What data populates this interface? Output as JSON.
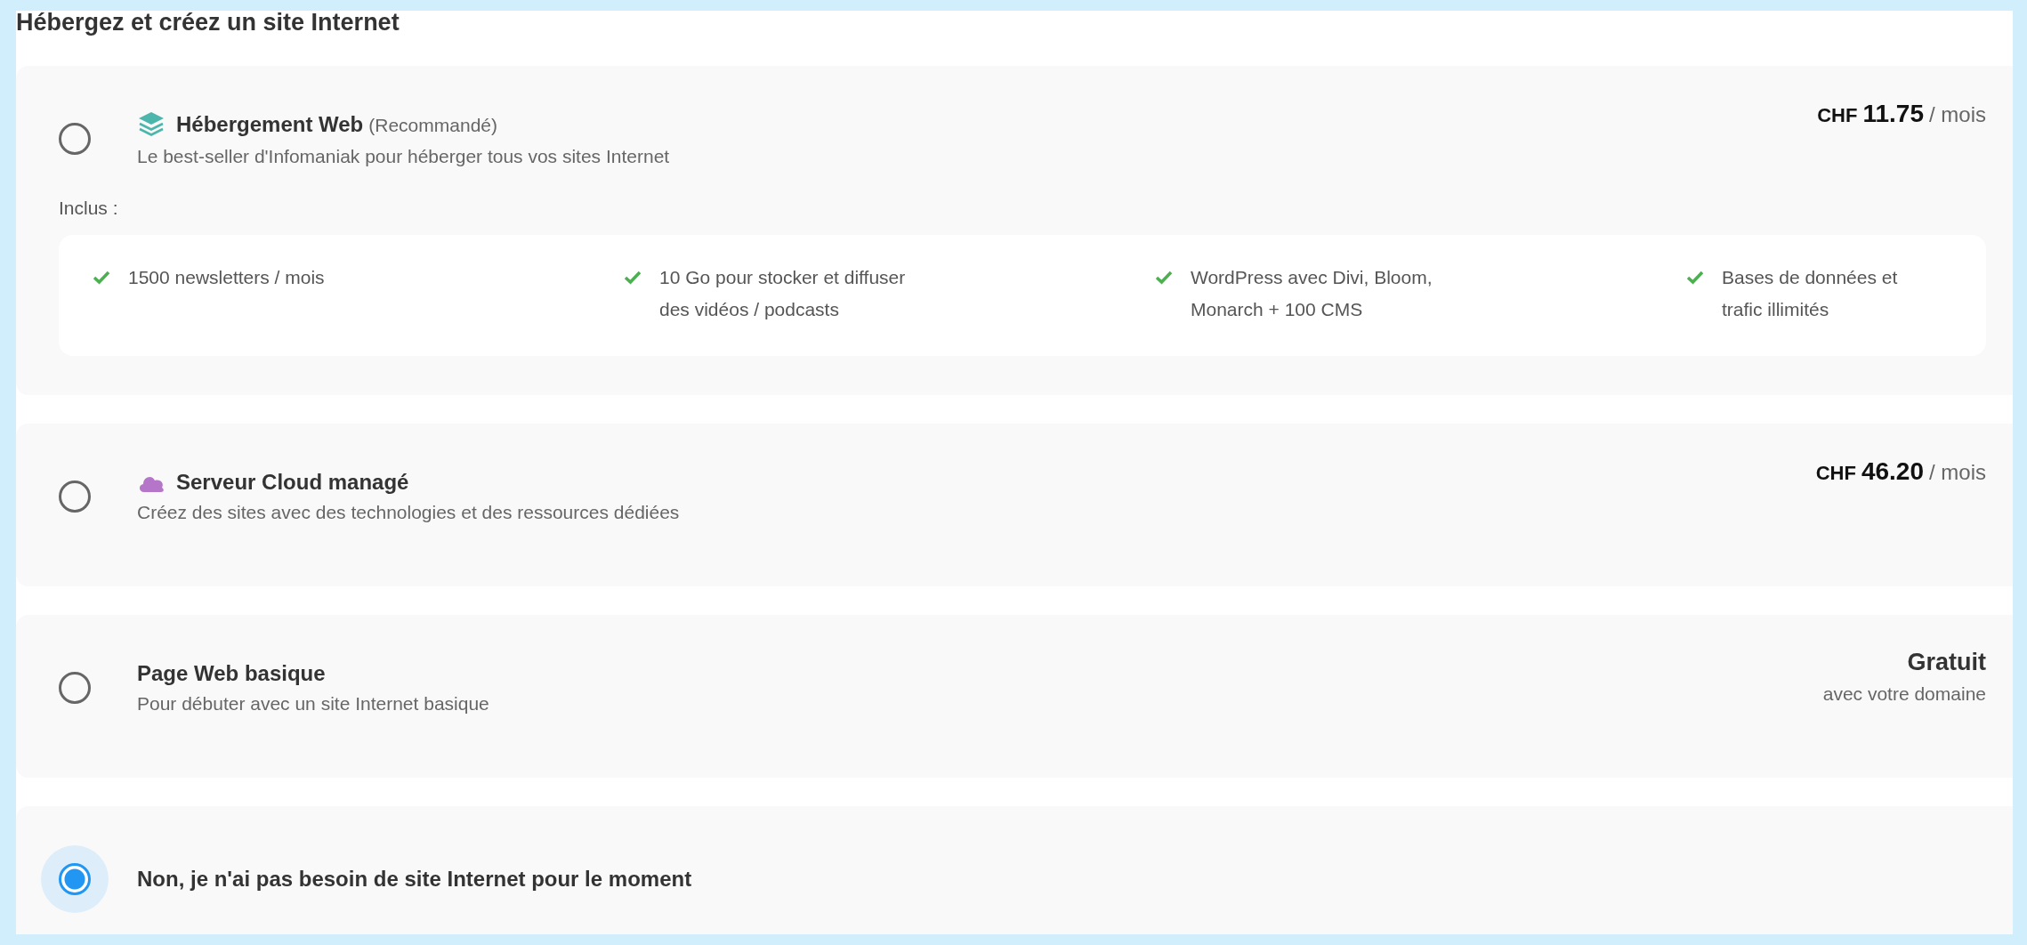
{
  "title": "Hébergez et créez un site Internet",
  "options": [
    {
      "kind": "web_hosting",
      "name": "Hébergement Web",
      "note": "(Recommandé)",
      "description": "Le best-seller d'Infomaniak pour héberger tous vos sites Internet",
      "selected": false,
      "price": {
        "kind": "monthly",
        "currency": "CHF",
        "amount": "11.75",
        "period": "/ mois"
      },
      "included_label": "Inclus :",
      "features": [
        "1500 newsletters / mois",
        "10 Go pour stocker et diffuser des vidéos / podcasts",
        "WordPress avec Divi, Bloom, Monarch + 100 CMS",
        "Bases de données et trafic illimités"
      ]
    },
    {
      "kind": "cloud_server",
      "name": "Serveur Cloud managé",
      "description": "Créez des sites avec des technologies et des ressources dédiées",
      "selected": false,
      "price": {
        "kind": "monthly",
        "currency": "CHF",
        "amount": "46.20",
        "period": "/ mois"
      }
    },
    {
      "kind": "basic_page",
      "name": "Page Web basique",
      "description": "Pour débuter avec un site Internet basique",
      "selected": false,
      "price": {
        "kind": "free",
        "label": "Gratuit",
        "note": "avec votre domaine"
      }
    },
    {
      "kind": "no_site",
      "name": "Non, je n'ai pas besoin de site Internet pour le moment",
      "selected": true
    }
  ]
}
